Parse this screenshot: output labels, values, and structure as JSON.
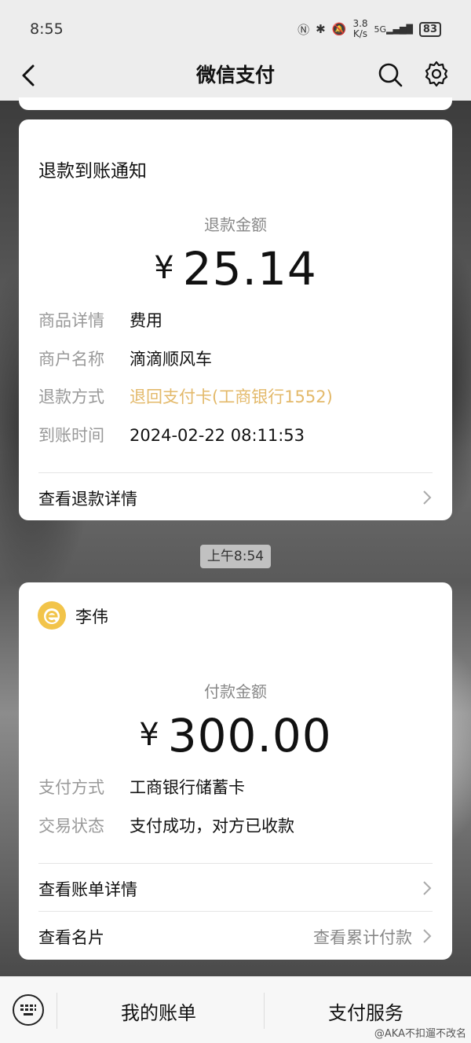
{
  "status": {
    "time": "8:55",
    "network_speed_value": "3.8",
    "network_speed_unit": "K/s",
    "signal": "5G",
    "battery": "83"
  },
  "nav": {
    "title": "微信支付"
  },
  "refund_card": {
    "title": "退款到账通知",
    "amount_label": "退款金额",
    "currency": "¥",
    "amount": "25.14",
    "rows": [
      {
        "key": "商品详情",
        "value": "费用"
      },
      {
        "key": "商户名称",
        "value": "滴滴顺风车"
      },
      {
        "key": "退款方式",
        "value": "退回支付卡(工商银行1552)"
      },
      {
        "key": "到账时间",
        "value": "2024-02-22 08:11:53"
      }
    ],
    "link": "查看退款详情"
  },
  "timestamp": "上午8:54",
  "payment_card": {
    "sender": "李伟",
    "amount_label": "付款金额",
    "currency": "¥",
    "amount": "300.00",
    "rows": [
      {
        "key": "支付方式",
        "value": "工商银行储蓄卡"
      },
      {
        "key": "交易状态",
        "value": "支付成功，对方已收款"
      }
    ],
    "link_bill": "查看账单详情",
    "link_card": "查看名片",
    "link_card_right": "查看累计付款"
  },
  "bottom": {
    "tab_bill": "我的账单",
    "tab_service": "支付服务",
    "watermark": "@AKA不扣遛不改名"
  },
  "colors": {
    "gold_text": "#e3b96a",
    "avatar": "#f2c44a"
  }
}
